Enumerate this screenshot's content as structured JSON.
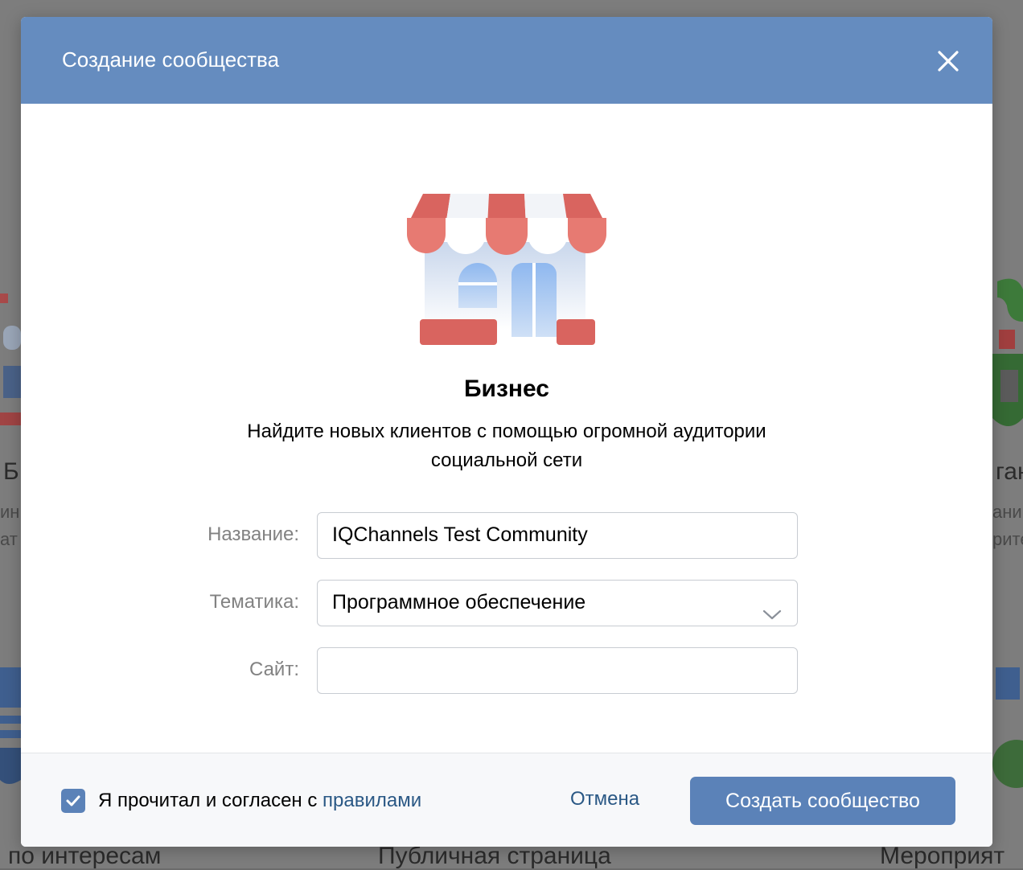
{
  "background": {
    "left_title_fragment": "Б",
    "left_sub_1": "ин",
    "left_sub_2": "ат",
    "right_title_fragment": "ган",
    "right_sub_1": "ани",
    "right_sub_2": "рите",
    "bottom_left_label": "по интересам",
    "bottom_center_label": "Публичная страница",
    "bottom_right_label": "Мероприят"
  },
  "modal": {
    "title": "Создание сообщества",
    "close_icon": "close-icon",
    "category": {
      "icon": "shop-icon",
      "title": "Бизнес",
      "description": "Найдите новых клиентов с помощью огромной аудитории социальной сети"
    },
    "form": {
      "name": {
        "label": "Название:",
        "value": "IQChannels Test Community"
      },
      "topic": {
        "label": "Тематика:",
        "value": "Программное обеспечение"
      },
      "site": {
        "label": "Сайт:",
        "value": ""
      }
    },
    "footer": {
      "agree_text": "Я прочитал и согласен с ",
      "rules_link": "правилами",
      "agree_checked": true,
      "cancel_label": "Отмена",
      "create_label": "Создать сообщество"
    }
  },
  "colors": {
    "header": "#658cbf",
    "primary_button": "#5b82b8",
    "link": "#2a5885"
  }
}
